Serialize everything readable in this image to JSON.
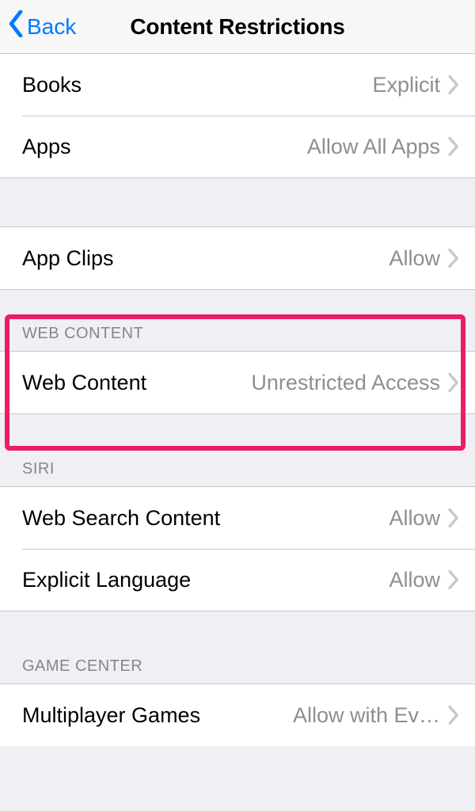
{
  "nav": {
    "back_label": "Back",
    "title": "Content Restrictions"
  },
  "group0": {
    "rows": [
      {
        "label": "Books",
        "value": "Explicit"
      },
      {
        "label": "Apps",
        "value": "Allow All Apps"
      }
    ]
  },
  "group1": {
    "rows": [
      {
        "label": "App Clips",
        "value": "Allow"
      }
    ]
  },
  "group2": {
    "header": "WEB CONTENT",
    "rows": [
      {
        "label": "Web Content",
        "value": "Unrestricted Access"
      }
    ]
  },
  "group3": {
    "header": "SIRI",
    "rows": [
      {
        "label": "Web Search Content",
        "value": "Allow"
      },
      {
        "label": "Explicit Language",
        "value": "Allow"
      }
    ]
  },
  "group4": {
    "header": "GAME CENTER",
    "rows": [
      {
        "label": "Multiplayer Games",
        "value": "Allow with Ev…"
      }
    ]
  }
}
